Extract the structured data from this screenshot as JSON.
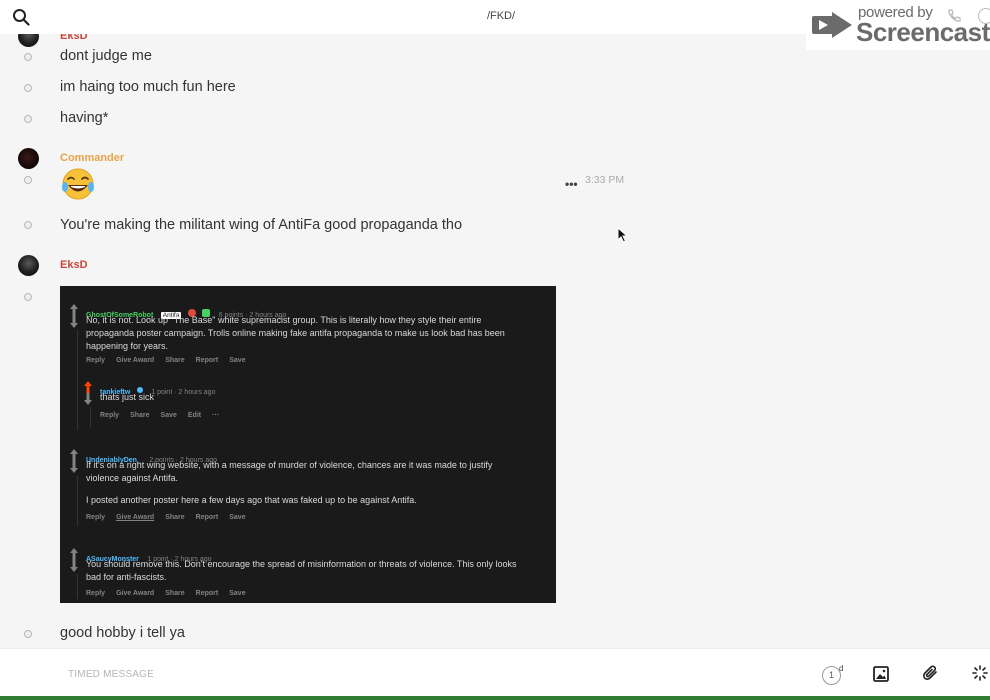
{
  "header": {
    "room_name": "/FKD/"
  },
  "watermark": {
    "line1": "powered by",
    "line2": "Screencastify"
  },
  "messages": {
    "top_author": "EksD",
    "m1": "dont judge me",
    "m2": "im haing too much fun here",
    "m3": "having*",
    "commander_author": "Commander",
    "emoji_label": "tears-of-joy-emoji",
    "time": "3:33 PM",
    "m4": "You're making the militant wing of AntiFa good propaganda tho",
    "eks_author": "EksD",
    "m5": "good hobby i tell ya"
  },
  "screenshot": {
    "comment1": {
      "user": "GhostOfSomeRobot",
      "flair": "Antifa",
      "meta": "6 points · 2 hours ago",
      "line1": "No, it is not. Look up \"The Base\" white supremacist group. This is literally how they style their entire",
      "line2": "propaganda poster campaign. Trolls online making fake antifa propaganda to make us look bad has been",
      "line3": "happening for years.",
      "actions": [
        "Reply",
        "Give Award",
        "Share",
        "Report",
        "Save"
      ]
    },
    "comment2": {
      "user": "tankieftw",
      "meta": "1 point · 2 hours ago",
      "line1": "thats just sick",
      "actions": [
        "Reply",
        "Share",
        "Save",
        "Edit",
        "···"
      ]
    },
    "comment3": {
      "user": "UndeniablyDen_",
      "meta": "2 points · 2 hours ago",
      "line1": "If it's on a right wing website, with a message of murder of violence, chances are it was made to justify",
      "line2": "violence against Antifa.",
      "line3": "I posted another poster here a few days ago that was faked up to be against Antifa.",
      "actions": [
        "Reply",
        "Give Award",
        "Share",
        "Report",
        "Save"
      ]
    },
    "comment4": {
      "user": "ASaucyMonster",
      "meta": "1 point · 2 hours ago",
      "line1": "You should remove this. Don't encourage the spread of misinformation or threats of violence. This only looks",
      "line2": "bad for anti-fascists.",
      "actions": [
        "Reply",
        "Give Award",
        "Share",
        "Report",
        "Save"
      ]
    }
  },
  "composer": {
    "placeholder": "TIMED MESSAGE",
    "timer_value": "1",
    "timer_unit": "d"
  },
  "colors": {
    "eks_author": "#c8473c",
    "commander_author": "#e8a44a",
    "reddit_bg": "#1a1a1b",
    "reddit_user_green": "#46d160",
    "reddit_user_blue": "#4fbcff",
    "upvote_orange": "#ff4500"
  }
}
